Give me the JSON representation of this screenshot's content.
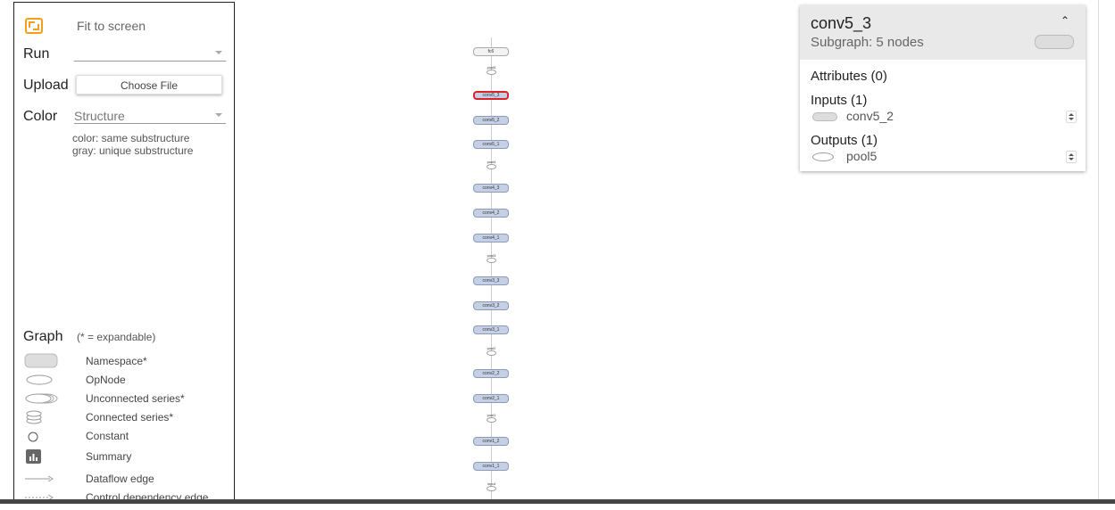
{
  "sidebar": {
    "fit_label": "Fit to screen",
    "run_label": "Run",
    "run_value": "",
    "upload_label": "Upload",
    "upload_button": "Choose File",
    "color_label": "Color",
    "color_value": "Structure",
    "color_desc_1": "color: same substructure",
    "color_desc_2": "gray: unique substructure",
    "graph_title": "Graph",
    "graph_note": "(* = expandable)",
    "legend": [
      {
        "label": "Namespace*",
        "icon": "namespace-icon"
      },
      {
        "label": "OpNode",
        "icon": "opnode-icon"
      },
      {
        "label": "Unconnected series*",
        "icon": "unconnected-series-icon"
      },
      {
        "label": "Connected series*",
        "icon": "connected-series-icon"
      },
      {
        "label": "Constant",
        "icon": "constant-icon"
      },
      {
        "label": "Summary",
        "icon": "summary-icon"
      },
      {
        "label": "Dataflow edge",
        "icon": "dataflow-edge-icon"
      },
      {
        "label": "Control dependency edge",
        "icon": "control-edge-icon"
      }
    ]
  },
  "graph": {
    "nodes": [
      {
        "label": "fc6",
        "kind": "fc"
      },
      {
        "label": "pool5",
        "kind": "op"
      },
      {
        "label": "conv5_3",
        "kind": "ns",
        "selected": true
      },
      {
        "label": "conv5_2",
        "kind": "ns"
      },
      {
        "label": "conv5_1",
        "kind": "ns"
      },
      {
        "label": "pool4",
        "kind": "op"
      },
      {
        "label": "conv4_3",
        "kind": "ns"
      },
      {
        "label": "conv4_2",
        "kind": "ns"
      },
      {
        "label": "conv4_1",
        "kind": "ns"
      },
      {
        "label": "pool3",
        "kind": "op"
      },
      {
        "label": "conv3_3",
        "kind": "ns"
      },
      {
        "label": "conv3_2",
        "kind": "ns"
      },
      {
        "label": "conv3_1",
        "kind": "ns"
      },
      {
        "label": "pool2",
        "kind": "op"
      },
      {
        "label": "conv2_2",
        "kind": "ns"
      },
      {
        "label": "conv2_1",
        "kind": "ns"
      },
      {
        "label": "pool1",
        "kind": "op"
      },
      {
        "label": "conv1_2",
        "kind": "ns"
      },
      {
        "label": "conv1_1",
        "kind": "ns"
      },
      {
        "label": "input",
        "kind": "op"
      }
    ]
  },
  "info": {
    "title": "conv5_3",
    "subtitle": "Subgraph: 5 nodes",
    "attributes": "Attributes (0)",
    "inputs_title": "Inputs (1)",
    "input_name": "conv5_2",
    "outputs_title": "Outputs (1)",
    "output_name": "pool5"
  },
  "colors": {
    "accent": "#f19f1c",
    "namespace_fill": "#c5d0e4",
    "selected_border": "#d9232b"
  }
}
